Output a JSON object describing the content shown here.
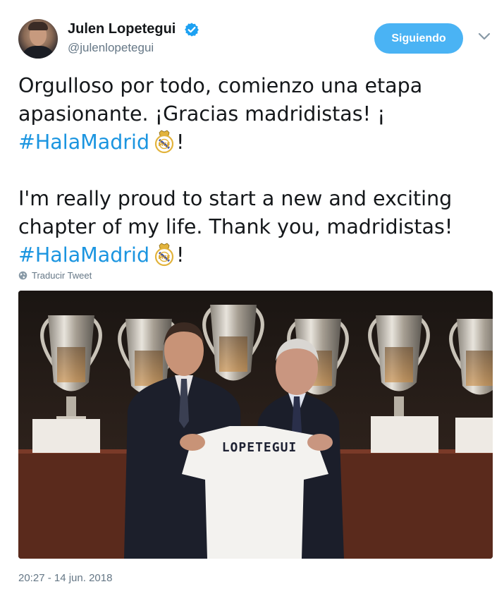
{
  "user": {
    "name": "Julen Lopetegui",
    "handle": "@julenlopetegui"
  },
  "follow_button": {
    "label": "Siguiendo"
  },
  "tweet": {
    "line1": "Orgulloso por todo, comienzo una etapa",
    "line2": "apasionante. ¡Gracias madridistas! ¡",
    "hashtag": "#HalaMadrid",
    "exclaim": "!",
    "line4": "I'm really proud to start a new and exciting",
    "line5": "chapter of my life. Thank you, madridistas!"
  },
  "translate": {
    "label": "Traducir Tweet"
  },
  "photo": {
    "shirt_text": "LOPETEGUI"
  },
  "timestamp": "20:27 - 14 jun. 2018",
  "icons": {
    "verified": "verified-badge-icon",
    "chevron": "chevron-down-icon",
    "globe": "globe-icon",
    "crest": "real-madrid-crest-emoji"
  },
  "colors": {
    "accent": "#1b95e0",
    "button": "#4ab3f4",
    "secondary_text": "#657786"
  }
}
